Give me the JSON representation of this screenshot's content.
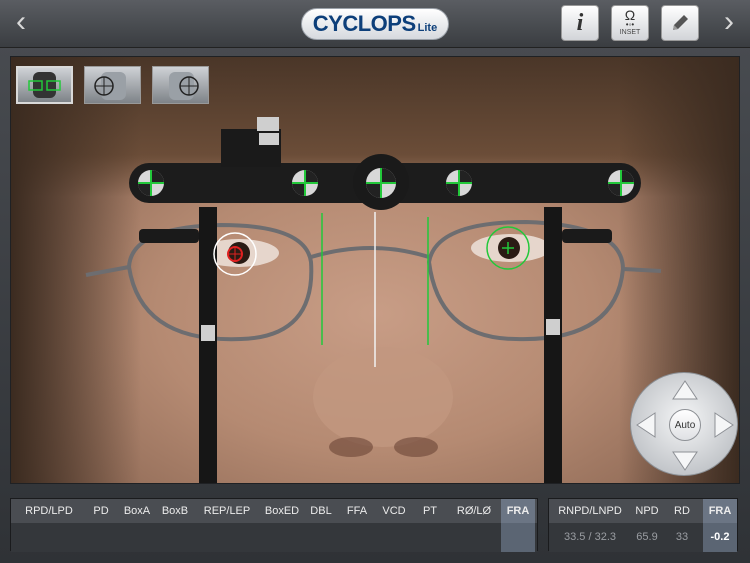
{
  "app": {
    "logo_main": "CYCLOPS",
    "logo_sub": "Lite"
  },
  "toolbar": {
    "back_label": "‹",
    "forward_label": "›",
    "info_label": "i",
    "inset_label": "INSET"
  },
  "joystick": {
    "auto_label": "Auto"
  },
  "measurements": {
    "left_headers": [
      "RPD/LPD",
      "PD",
      "BoxA",
      "BoxB",
      "REP/LEP",
      "BoxED",
      "DBL",
      "FFA",
      "VCD",
      "PT",
      "RØ/LØ",
      "FRA"
    ],
    "right_headers": [
      "RNPD/LNPD",
      "NPD",
      "RD",
      "FRA"
    ],
    "right_values": [
      "33.5 / 32.3",
      "65.9",
      "33",
      "-0.2"
    ]
  },
  "colors": {
    "accent_green": "#22c83a",
    "marker_red": "#e02020",
    "selected_column": "#6b7584"
  }
}
